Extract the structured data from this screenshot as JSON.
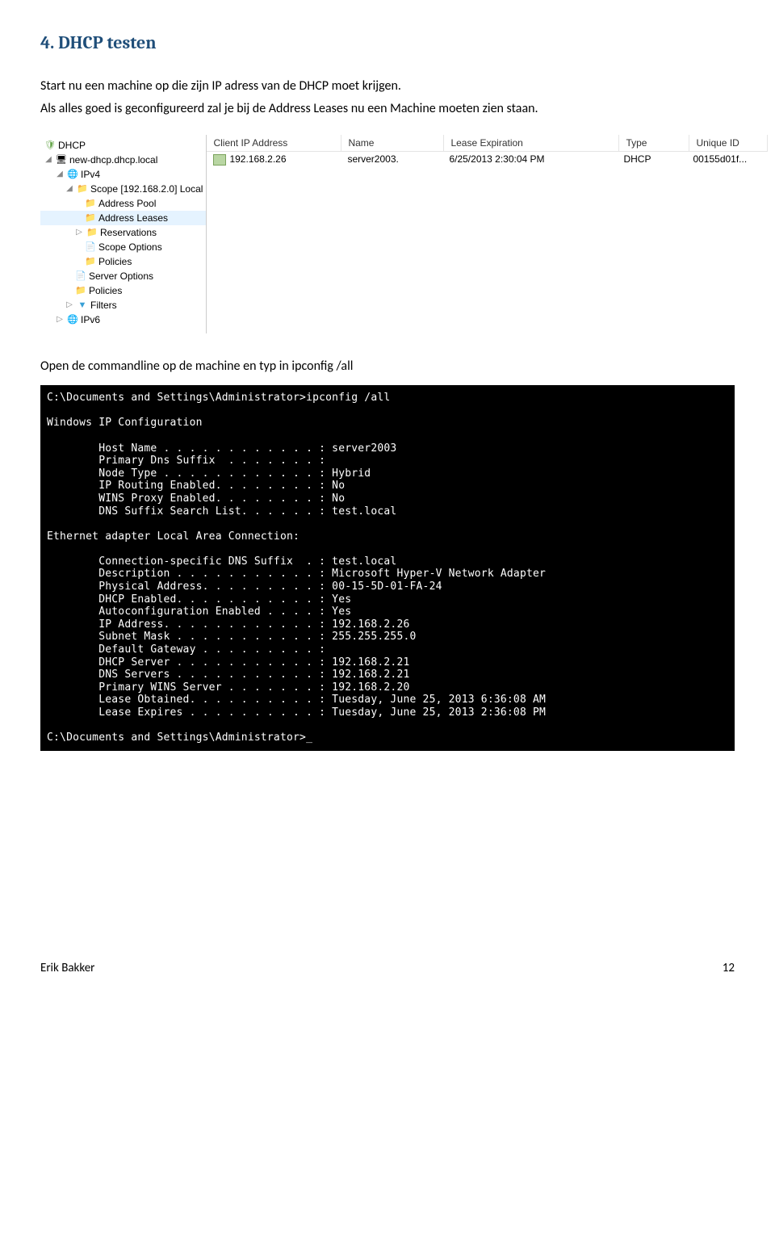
{
  "heading": "4.  DHCP testen",
  "para1": "Start nu een machine op die zijn IP adress van de DHCP moet krijgen.",
  "para2": "Als alles goed is geconfigureerd zal je bij de Address Leases nu een Machine moeten zien staan.",
  "tree": {
    "root": "DHCP",
    "server": "new-dhcp.dhcp.local",
    "ipv4": "IPv4",
    "scope": "Scope [192.168.2.0] Local",
    "pool": "Address Pool",
    "leases": "Address Leases",
    "reservations": "Reservations",
    "scopeopt": "Scope Options",
    "policies": "Policies",
    "serveropt": "Server Options",
    "policies2": "Policies",
    "filters": "Filters",
    "ipv6": "IPv6"
  },
  "list": {
    "h_ip": "Client IP Address",
    "h_name": "Name",
    "h_lease": "Lease Expiration",
    "h_type": "Type",
    "h_uid": "Unique ID",
    "r_ip": "192.168.2.26",
    "r_name": "server2003.",
    "r_lease": "6/25/2013 2:30:04 PM",
    "r_type": "DHCP",
    "r_uid": "00155d01f..."
  },
  "para3": "Open de commandline op de machine en typ in ipconfig /all",
  "terminal": "C:\\Documents and Settings\\Administrator>ipconfig /all\n\nWindows IP Configuration\n\n        Host Name . . . . . . . . . . . . : server2003\n        Primary Dns Suffix  . . . . . . . :\n        Node Type . . . . . . . . . . . . : Hybrid\n        IP Routing Enabled. . . . . . . . : No\n        WINS Proxy Enabled. . . . . . . . : No\n        DNS Suffix Search List. . . . . . : test.local\n\nEthernet adapter Local Area Connection:\n\n        Connection-specific DNS Suffix  . : test.local\n        Description . . . . . . . . . . . : Microsoft Hyper-V Network Adapter\n        Physical Address. . . . . . . . . : 00-15-5D-01-FA-24\n        DHCP Enabled. . . . . . . . . . . : Yes\n        Autoconfiguration Enabled . . . . : Yes\n        IP Address. . . . . . . . . . . . : 192.168.2.26\n        Subnet Mask . . . . . . . . . . . : 255.255.255.0\n        Default Gateway . . . . . . . . . :\n        DHCP Server . . . . . . . . . . . : 192.168.2.21\n        DNS Servers . . . . . . . . . . . : 192.168.2.21\n        Primary WINS Server . . . . . . . : 192.168.2.20\n        Lease Obtained. . . . . . . . . . : Tuesday, June 25, 2013 6:36:08 AM\n        Lease Expires . . . . . . . . . . : Tuesday, June 25, 2013 2:36:08 PM\n\nC:\\Documents and Settings\\Administrator>_",
  "footer_left": "Erik Bakker",
  "footer_right": "12"
}
